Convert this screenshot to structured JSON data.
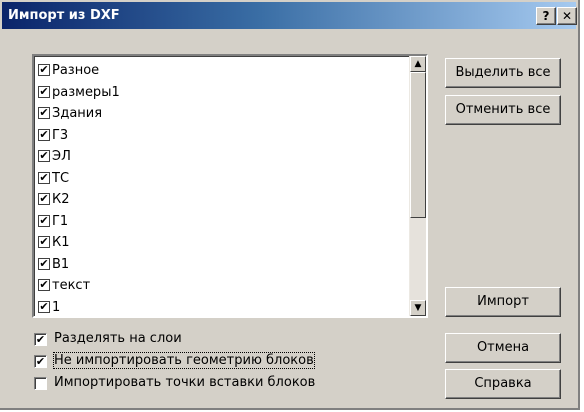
{
  "title": "Импорт из DXF",
  "title_buttons": {
    "help": "?",
    "close": "✕"
  },
  "layers": [
    {
      "label": "Разное",
      "checked": true
    },
    {
      "label": "размеры1",
      "checked": true
    },
    {
      "label": "Здания",
      "checked": true
    },
    {
      "label": "Г3",
      "checked": true
    },
    {
      "label": "ЭЛ",
      "checked": true
    },
    {
      "label": "ТС",
      "checked": true
    },
    {
      "label": "К2",
      "checked": true
    },
    {
      "label": "Г1",
      "checked": true
    },
    {
      "label": "К1",
      "checked": true
    },
    {
      "label": "В1",
      "checked": true
    },
    {
      "label": "текст",
      "checked": true
    },
    {
      "label": "1",
      "checked": true
    }
  ],
  "buttons": {
    "select_all": "Выделить все",
    "deselect_all": "Отменить все",
    "import": "Импорт",
    "cancel": "Отмена",
    "help": "Справка"
  },
  "options": {
    "split_layers": {
      "label": "Разделять на слои",
      "checked": true
    },
    "no_block_geometry": {
      "label": "Не импортировать геометрию блоков",
      "checked": true
    },
    "insert_points": {
      "label": "Импортировать точки вставки блоков",
      "checked": false
    }
  },
  "check_mark": "✔"
}
